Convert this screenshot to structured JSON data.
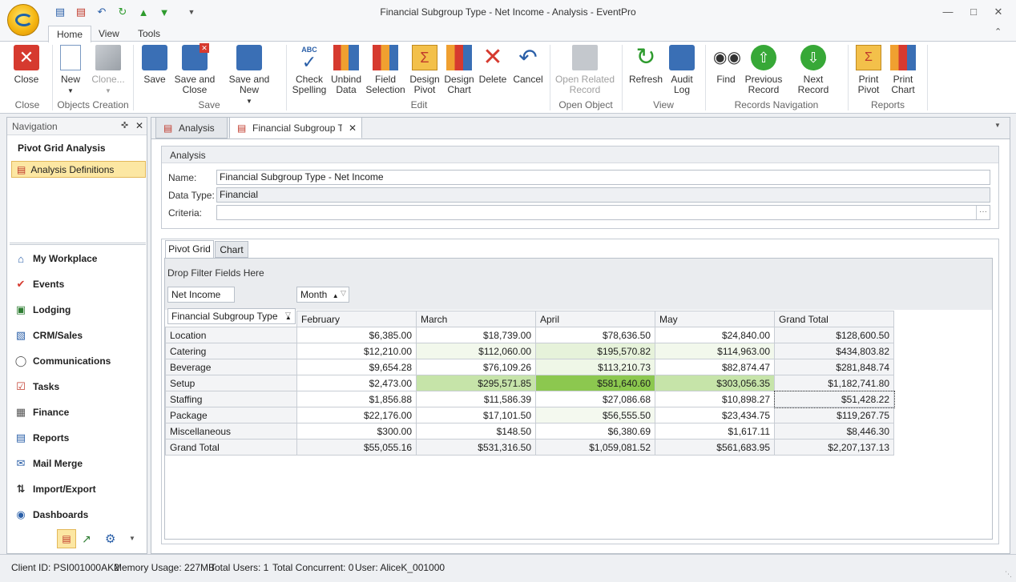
{
  "window": {
    "title": "Financial Subgroup Type - Net Income - Analysis - EventPro"
  },
  "ribbon": {
    "tabs": [
      "Home",
      "View",
      "Tools"
    ],
    "groups": {
      "close": "Close",
      "objects_creation": "Objects Creation",
      "save": "Save",
      "edit": "Edit",
      "open_object": "Open Object",
      "view": "View",
      "records_navigation": "Records Navigation",
      "reports": "Reports"
    },
    "buttons": {
      "close": "Close",
      "new": "New",
      "clone": "Clone...",
      "save": "Save",
      "save_and_close": "Save and Close",
      "save_and_new": "Save and New",
      "check_spelling": "Check Spelling",
      "unbind_data": "Unbind Data",
      "field_selection": "Field Selection",
      "design_pivot": "Design Pivot",
      "design_chart": "Design Chart",
      "delete": "Delete",
      "cancel": "Cancel",
      "open_related_record": "Open Related Record",
      "refresh": "Refresh",
      "audit_log": "Audit Log",
      "find": "Find",
      "previous_record": "Previous Record",
      "next_record": "Next Record",
      "print_pivot": "Print Pivot",
      "print_chart": "Print Chart"
    }
  },
  "navigation": {
    "header": "Navigation",
    "section_title": "Pivot Grid Analysis",
    "selected_item": "Analysis Definitions",
    "modules": [
      "My Workplace",
      "Events",
      "Lodging",
      "CRM/Sales",
      "Communications",
      "Tasks",
      "Finance",
      "Reports",
      "Mail Merge",
      "Import/Export",
      "Dashboards"
    ]
  },
  "doc_tabs": [
    "Analysis",
    "Financial Subgroup Type"
  ],
  "analysis": {
    "group_title": "Analysis",
    "name_label": "Name:",
    "name_value": "Financial Subgroup Type - Net Income",
    "data_type_label": "Data Type:",
    "data_type_value": "Financial",
    "criteria_label": "Criteria:",
    "criteria_value": "",
    "criteria_button": "···"
  },
  "inner_tabs": [
    "Pivot Grid",
    "Chart"
  ],
  "pivot": {
    "filter_area": "Drop Filter Fields Here",
    "data_field": "Net Income",
    "column_field": "Month",
    "row_field": "Financial Subgroup Type",
    "columns": [
      "February",
      "March",
      "April",
      "May",
      "Grand Total"
    ],
    "rows": [
      {
        "label": "Location",
        "values": [
          "$6,385.00",
          "$18,739.00",
          "$78,636.50",
          "$24,840.00",
          "$128,600.50"
        ]
      },
      {
        "label": "Catering",
        "values": [
          "$12,210.00",
          "$112,060.00",
          "$195,570.82",
          "$114,963.00",
          "$434,803.82"
        ]
      },
      {
        "label": "Beverage",
        "values": [
          "$9,654.28",
          "$76,109.26",
          "$113,210.73",
          "$82,874.47",
          "$281,848.74"
        ]
      },
      {
        "label": "Setup",
        "values": [
          "$2,473.00",
          "$295,571.85",
          "$581,640.60",
          "$303,056.35",
          "$1,182,741.80"
        ]
      },
      {
        "label": "Staffing",
        "values": [
          "$1,856.88",
          "$11,586.39",
          "$27,086.68",
          "$10,898.27",
          "$51,428.22"
        ]
      },
      {
        "label": "Package",
        "values": [
          "$22,176.00",
          "$17,101.50",
          "$56,555.50",
          "$23,434.75",
          "$119,267.75"
        ]
      },
      {
        "label": "Miscellaneous",
        "values": [
          "$300.00",
          "$148.50",
          "$6,380.69",
          "$1,617.11",
          "$8,446.30"
        ]
      },
      {
        "label": "Grand Total",
        "values": [
          "$55,055.16",
          "$531,316.50",
          "$1,059,081.52",
          "$561,683.95",
          "$2,207,137.13"
        ]
      }
    ]
  },
  "status": {
    "client_id": "Client ID: PSI001000AK2",
    "memory": "Memory Usage: 227MB",
    "total_users": "Total Users: 1",
    "total_concurrent": "Total Concurrent: 0",
    "user": "User: AliceK_001000"
  }
}
